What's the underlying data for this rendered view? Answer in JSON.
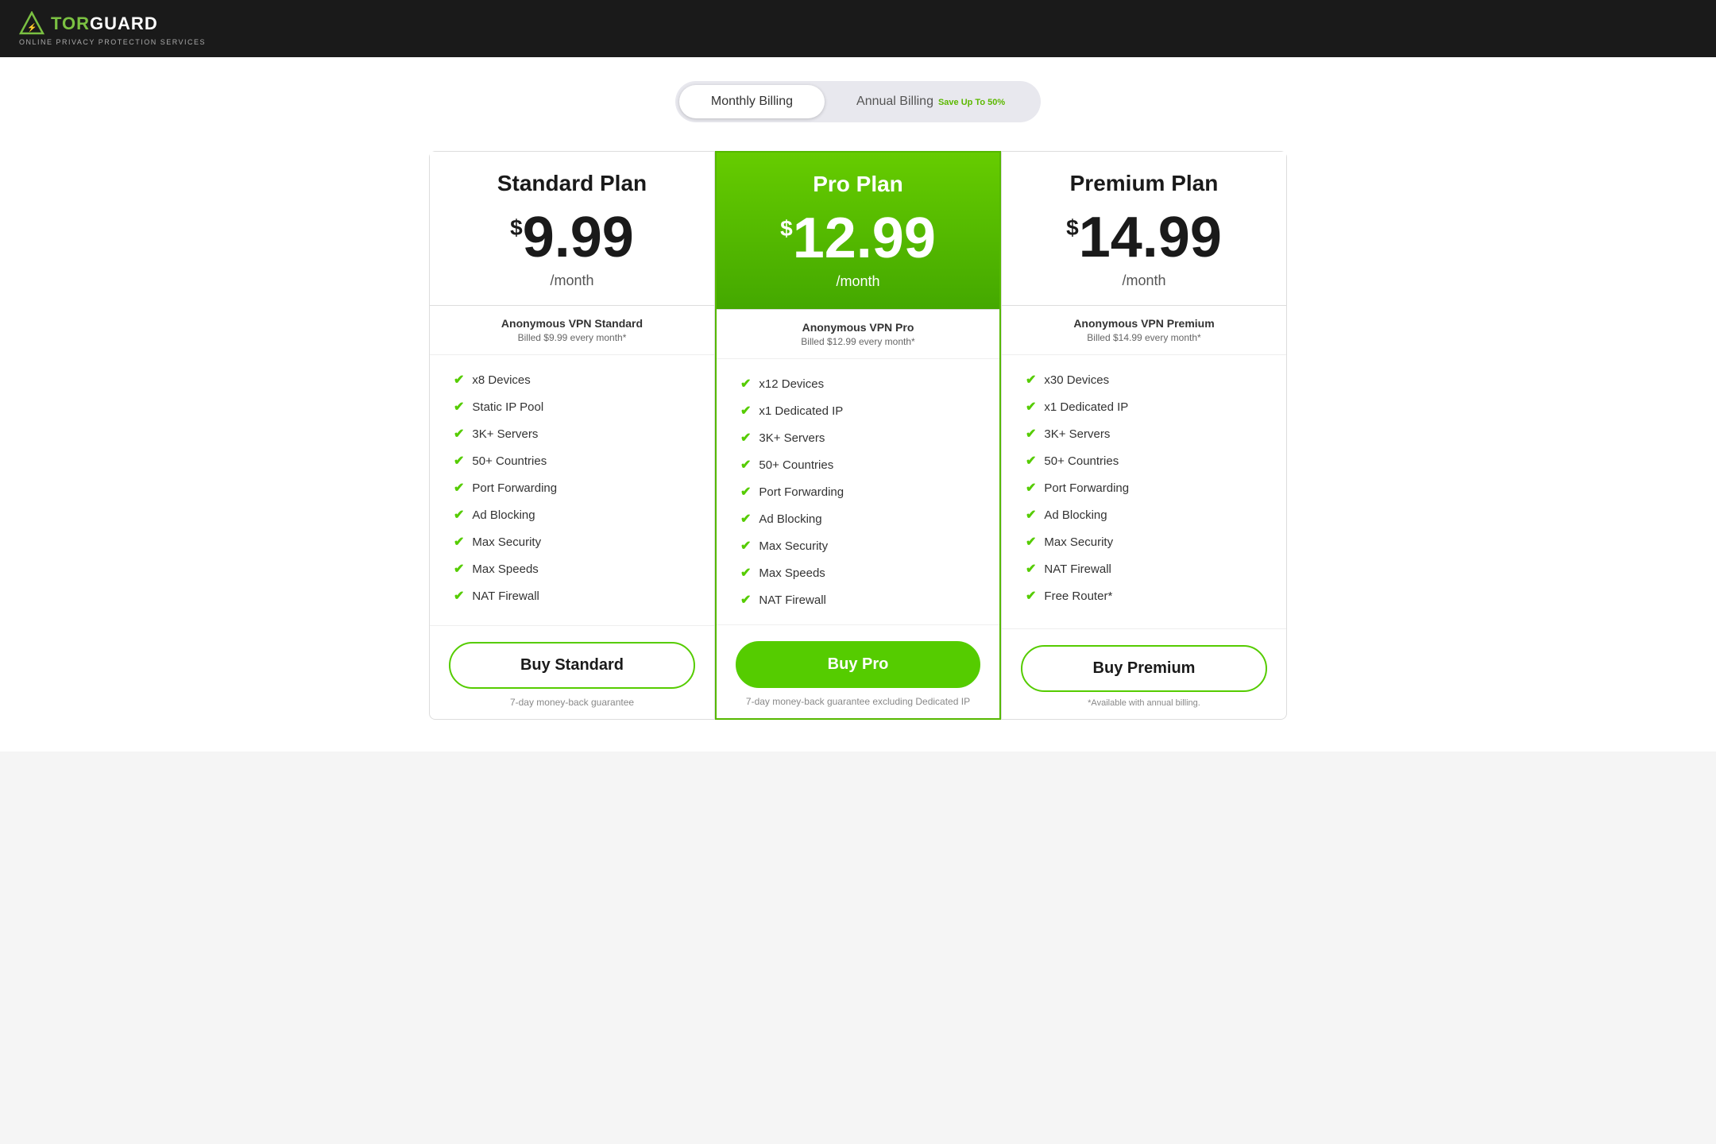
{
  "header": {
    "logo_tor": "TOR",
    "logo_guard": "GUARD",
    "logo_sub": "ONLINE PRIVACY PROTECTION SERVICES"
  },
  "billing_toggle": {
    "monthly_label": "Monthly Billing",
    "annual_label": "Annual Billing",
    "save_badge": "Save Up To 50%",
    "active": "monthly"
  },
  "plans": [
    {
      "id": "standard",
      "name": "Standard Plan",
      "currency": "$",
      "amount": "9.99",
      "period": "/month",
      "billing_title": "Anonymous VPN Standard",
      "billing_desc": "Billed $9.99 every month*",
      "featured": false,
      "features": [
        "x8 Devices",
        "Static IP Pool",
        "3K+ Servers",
        "50+ Countries",
        "Port Forwarding",
        "Ad Blocking",
        "Max Security",
        "Max Speeds",
        "NAT Firewall"
      ],
      "buy_label": "Buy Standard",
      "guarantee": "7-day money-back guarantee",
      "annual_note": null
    },
    {
      "id": "pro",
      "name": "Pro Plan",
      "currency": "$",
      "amount": "12.99",
      "period": "/month",
      "billing_title": "Anonymous VPN Pro",
      "billing_desc": "Billed $12.99 every month*",
      "featured": true,
      "features": [
        "x12 Devices",
        "x1 Dedicated IP",
        "3K+ Servers",
        "50+ Countries",
        "Port Forwarding",
        "Ad Blocking",
        "Max Security",
        "Max Speeds",
        "NAT Firewall"
      ],
      "buy_label": "Buy Pro",
      "guarantee": "7-day money-back guarantee excluding Dedicated IP",
      "annual_note": null
    },
    {
      "id": "premium",
      "name": "Premium Plan",
      "currency": "$",
      "amount": "14.99",
      "period": "/month",
      "billing_title": "Anonymous VPN Premium",
      "billing_desc": "Billed $14.99 every month*",
      "featured": false,
      "features": [
        "x30 Devices",
        "x1 Dedicated IP",
        "3K+ Servers",
        "50+ Countries",
        "Port Forwarding",
        "Ad Blocking",
        "Max Security",
        "NAT Firewall",
        "Free Router*"
      ],
      "buy_label": "Buy Premium",
      "guarantee": null,
      "annual_note": "*Available with annual billing."
    }
  ]
}
